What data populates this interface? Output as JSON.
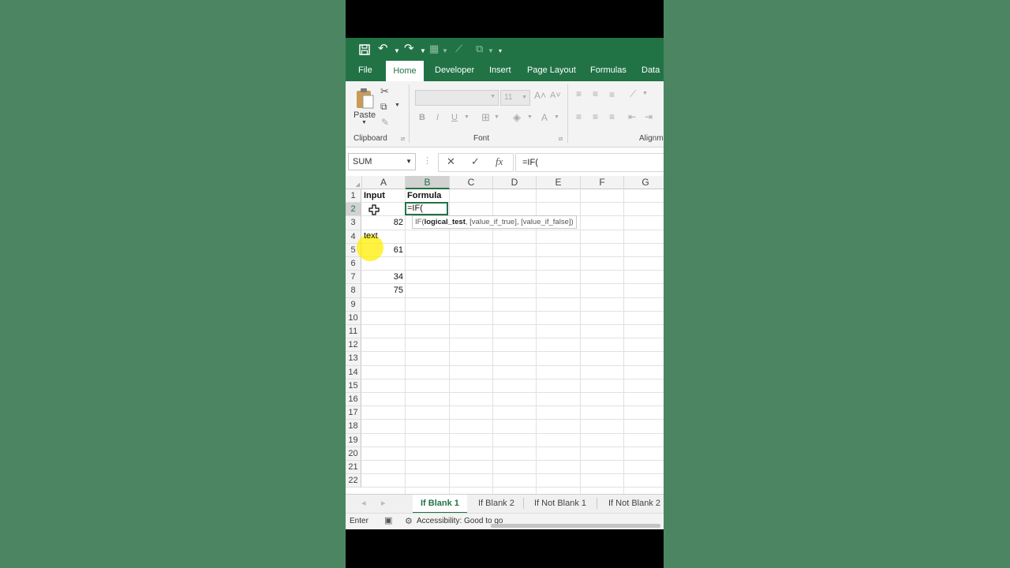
{
  "qat": {
    "save_icon": "save-icon",
    "undo_icon": "undo-icon",
    "redo_icon": "redo-icon"
  },
  "tabs": [
    "File",
    "Home",
    "Developer",
    "Insert",
    "Page Layout",
    "Formulas",
    "Data"
  ],
  "active_tab": "Home",
  "ribbon": {
    "paste_label": "Paste",
    "clipboard_label": "Clipboard",
    "font_label": "Font",
    "alignment_label": "Alignm",
    "font_size": "11",
    "bold": "B",
    "italic": "I",
    "underline": "U"
  },
  "formula_bar": {
    "name_box": "SUM",
    "cancel_symbol": "✕",
    "enter_symbol": "✓",
    "fx_symbol": "fx",
    "formula": "=IF("
  },
  "grid": {
    "columns": [
      "A",
      "B",
      "C",
      "D",
      "E",
      "F",
      "G"
    ],
    "rows": [
      "1",
      "2",
      "3",
      "4",
      "5",
      "6",
      "7",
      "8",
      "9",
      "10",
      "11",
      "12",
      "13",
      "14",
      "15",
      "16",
      "17",
      "18",
      "19",
      "20",
      "21",
      "22"
    ],
    "cells": {
      "A1": "Input",
      "B1": "Formula",
      "A3": "82",
      "A4": "text",
      "A5": "61",
      "A7": "34",
      "A8": "75",
      "B2": "=IF("
    },
    "tooltip": {
      "fn": "IF(",
      "arg1": "logical_test",
      "rest": ", [value_if_true], [value_if_false])"
    }
  },
  "sheets": [
    "If Blank 1",
    "If Blank 2",
    "If Not Blank 1",
    "If Not Blank 2"
  ],
  "active_sheet": "If Blank 1",
  "status": {
    "mode": "Enter",
    "accessibility": "Accessibility: Good to go"
  },
  "colors": {
    "excel_green": "#217346",
    "background": "#4c8562"
  }
}
